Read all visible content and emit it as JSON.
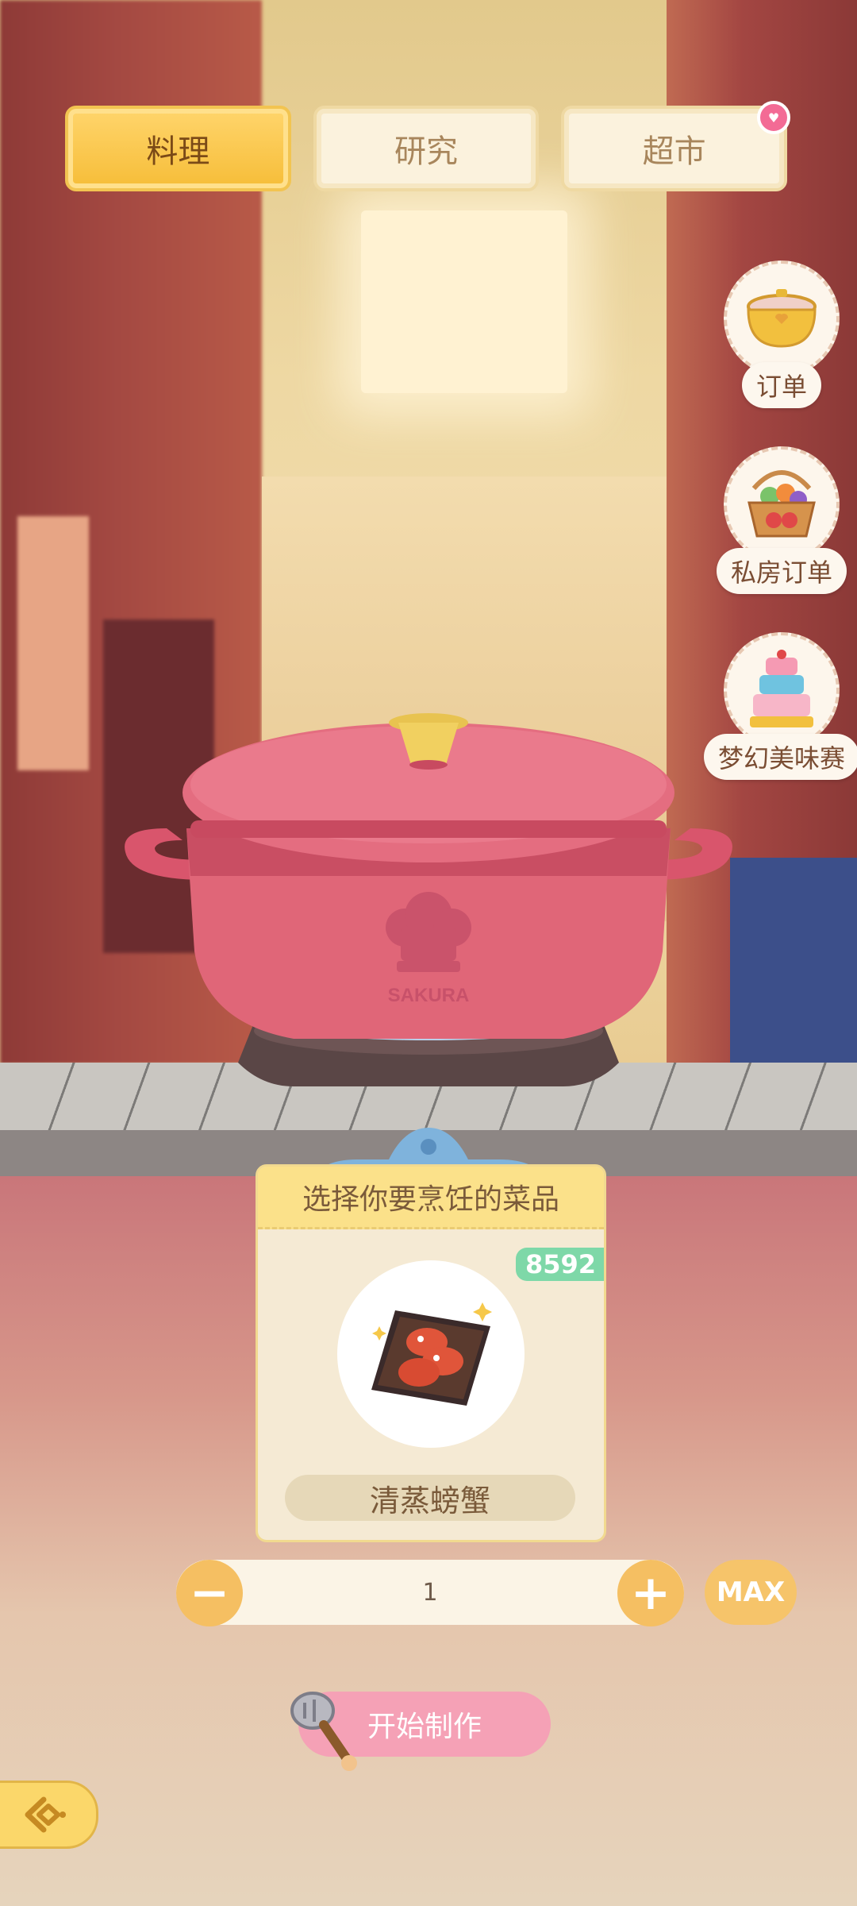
{
  "tabs": [
    {
      "label": "料理",
      "active": true
    },
    {
      "label": "研究",
      "active": false
    },
    {
      "label": "超市",
      "active": false,
      "has_notification": true
    }
  ],
  "side_buttons": [
    {
      "label": "订单",
      "icon": "golden-pot-icon"
    },
    {
      "label": "私房订单",
      "icon": "fruit-basket-icon"
    },
    {
      "label": "梦幻美味赛",
      "icon": "cake-icon"
    }
  ],
  "pot": {
    "brand": "SAKURA",
    "color": "#e06678"
  },
  "recipe_card": {
    "title": "选择你要烹饪的菜品",
    "owned_count": "8592",
    "dish_name": "清蒸螃蟹",
    "dish_icon": "steamed-crab-icon"
  },
  "quantity": {
    "minus": "−",
    "value": "1",
    "plus": "+",
    "max_label": "MAX"
  },
  "start_button": {
    "label": "开始制作"
  },
  "back_button": {
    "icon": "back-arrow-icon"
  },
  "colors": {
    "accent_yellow": "#f6bd38",
    "start_pink": "#f5a1b6",
    "badge_green": "#7ed8a8"
  }
}
